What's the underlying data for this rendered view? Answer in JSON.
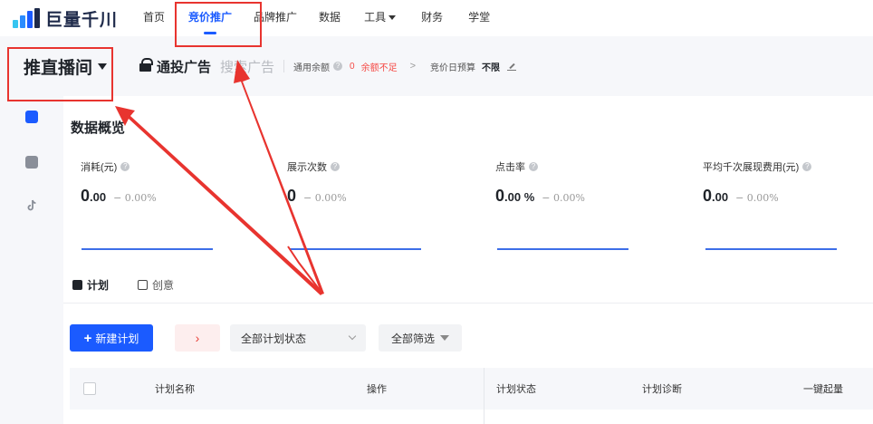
{
  "brand": {
    "name": "巨量千川"
  },
  "nav": {
    "items": [
      {
        "label": "首页"
      },
      {
        "label": "竞价推广"
      },
      {
        "label": "品牌推广"
      },
      {
        "label": "数据"
      },
      {
        "label": "工具"
      },
      {
        "label": "财务"
      },
      {
        "label": "学堂"
      }
    ]
  },
  "subbar": {
    "account": "推直播间",
    "bid_ad": "通投广告",
    "search_ad": "搜索广告",
    "balance_label": "通用余额",
    "balance_value": "0",
    "balance_warning": "余额不足",
    "budget_label": "竞价日预算",
    "budget_value": "不限"
  },
  "overview": {
    "title": "数据概览",
    "metrics": [
      {
        "label": "消耗(元)",
        "num": "0",
        "dec": ".00",
        "change": "− 0.00%"
      },
      {
        "label": "展示次数",
        "num": "0",
        "dec": "",
        "change": "− 0.00%"
      },
      {
        "label": "点击率",
        "num": "0",
        "dec": ".00 %",
        "change": "− 0.00%"
      },
      {
        "label": "平均千次展现费用(元)",
        "num": "0",
        "dec": ".00",
        "change": "− 0.00%"
      }
    ]
  },
  "tabs": {
    "plan": "计划",
    "creative": "创意"
  },
  "toolbar": {
    "new_plan": "新建计划",
    "status_select": "全部计划状态",
    "filter": "全部筛选"
  },
  "table": {
    "columns": [
      "计划名称",
      "操作",
      "计划状态",
      "计划诊断",
      "一键起量"
    ]
  },
  "colors": {
    "accent": "#1b5bff",
    "annotation": "#e8342f",
    "warning": "#f54a45"
  }
}
